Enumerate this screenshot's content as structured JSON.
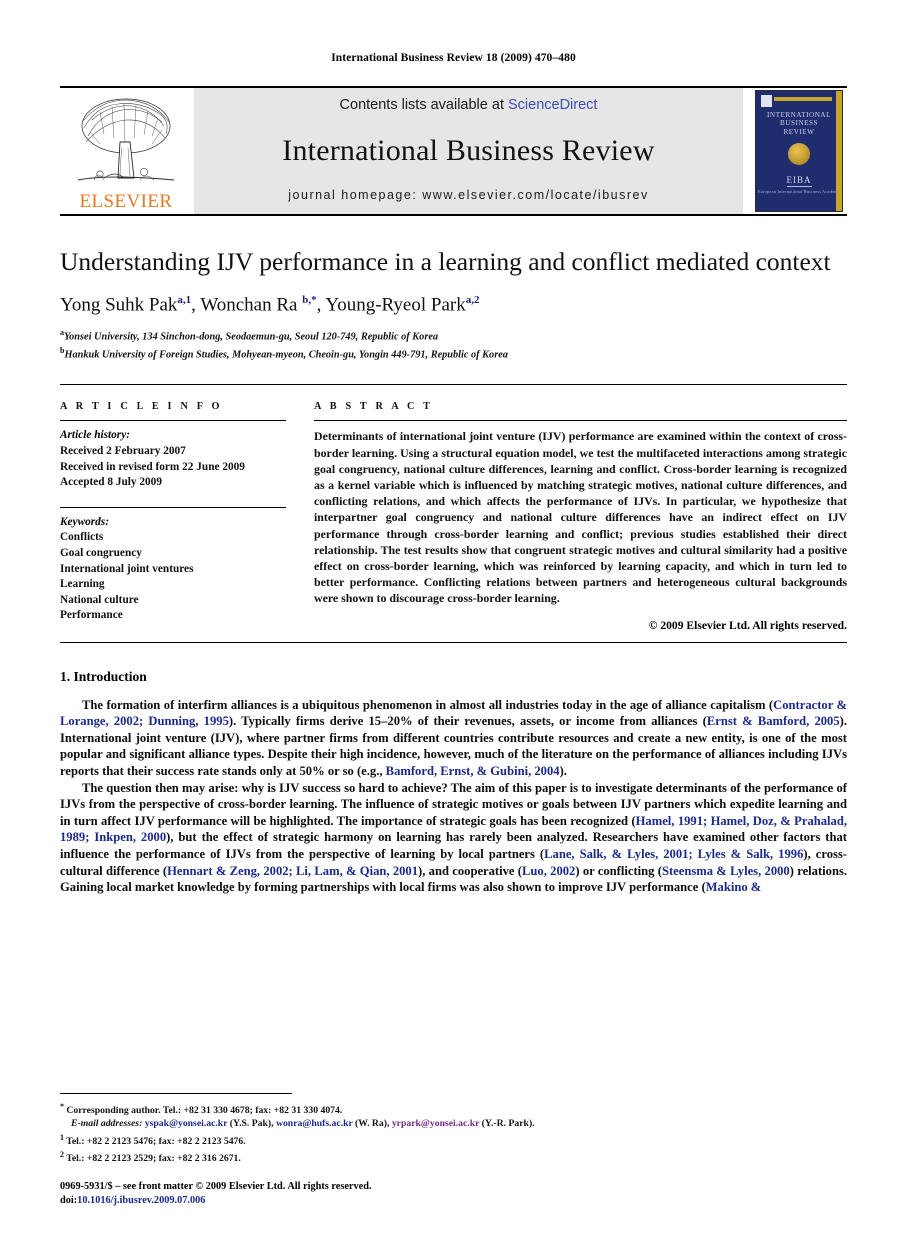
{
  "running_head": "International Business Review 18 (2009) 470–480",
  "masthead": {
    "publisher": "ELSEVIER",
    "contents_prefix": "Contents lists available at ",
    "contents_link": "ScienceDirect",
    "journal_title": "International Business Review",
    "homepage": "journal homepage: www.elsevier.com/locate/ibusrev",
    "cover": {
      "title_lines": [
        "INTERNATIONAL",
        "BUSINESS",
        "REVIEW"
      ],
      "society": "EIBA",
      "society_sub": "European International Business Academy"
    }
  },
  "article": {
    "title": "Understanding IJV performance in a learning and conflict mediated context",
    "authors": [
      {
        "name": "Yong Suhk Pak",
        "sup": "a,1"
      },
      {
        "name": "Wonchan Ra",
        "sup": "b,*"
      },
      {
        "name": "Young-Ryeol Park",
        "sup": "a,2"
      }
    ],
    "affiliations": [
      {
        "marker": "a",
        "text": "Yonsei University, 134 Sinchon-dong, Seodaemun-gu, Seoul 120-749, Republic of Korea"
      },
      {
        "marker": "b",
        "text": "Hankuk University of Foreign Studies, Mohyean-myeon, Cheoin-gu, Yongin 449-791, Republic of Korea"
      }
    ]
  },
  "info": {
    "heading": "A R T I C L E   I N F O",
    "history_label": "Article history:",
    "history": [
      "Received 2 February 2007",
      "Received in revised form 22 June 2009",
      "Accepted 8 July 2009"
    ],
    "keywords_label": "Keywords:",
    "keywords": [
      "Conflicts",
      "Goal congruency",
      "International joint ventures",
      "Learning",
      "National culture",
      "Performance"
    ]
  },
  "abstract": {
    "heading": "A B S T R A C T",
    "text": "Determinants of international joint venture (IJV) performance are examined within the context of cross-border learning. Using a structural equation model, we test the multifaceted interactions among strategic goal congruency, national culture differences, learning and conflict. Cross-border learning is recognized as a kernel variable which is influenced by matching strategic motives, national culture differences, and conflicting relations, and which affects the performance of IJVs. In particular, we hypothesize that interpartner goal congruency and national culture differences have an indirect effect on IJV performance through cross-border learning and conflict; previous studies established their direct relationship. The test results show that congruent strategic motives and cultural similarity had a positive effect on cross-border learning, which was reinforced by learning capacity, and which in turn led to better performance. Conflicting relations between partners and heterogeneous cultural backgrounds were shown to discourage cross-border learning.",
    "copyright": "© 2009 Elsevier Ltd. All rights reserved."
  },
  "introduction": {
    "heading": "1. Introduction",
    "paragraph1": [
      {
        "t": "The formation of interfirm alliances is a ubiquitous phenomenon in almost all industries today in the age of alliance capitalism ("
      },
      {
        "t": "Contractor & Lorange, 2002; Dunning, 1995",
        "c": true
      },
      {
        "t": "). Typically firms derive 15–20% of their revenues, assets, or income from alliances ("
      },
      {
        "t": "Ernst & Bamford, 2005",
        "c": true
      },
      {
        "t": "). International joint venture (IJV), where partner firms from different countries contribute resources and create a new entity, is one of the most popular and significant alliance types. Despite their high incidence, however, much of the literature on the performance of alliances including IJVs reports that their success rate stands only at 50% or so (e.g., "
      },
      {
        "t": "Bamford, Ernst, & Gubini, 2004",
        "c": true
      },
      {
        "t": ")."
      }
    ],
    "paragraph2": [
      {
        "t": "The question then may arise: why is IJV success so hard to achieve? The aim of this paper is to investigate determinants of the performance of IJVs from the perspective of cross-border learning. The influence of strategic motives or goals between IJV partners which expedite learning and in turn affect IJV performance will be highlighted. The importance of strategic goals has been recognized ("
      },
      {
        "t": "Hamel, 1991; Hamel, Doz, & Prahalad, 1989; Inkpen, 2000",
        "c": true
      },
      {
        "t": "), but the effect of strategic harmony on learning has rarely been analyzed. Researchers have examined other factors that influence the performance of IJVs from the perspective of learning by local partners ("
      },
      {
        "t": "Lane, Salk, & Lyles, 2001; Lyles & Salk, 1996",
        "c": true
      },
      {
        "t": "), cross-cultural difference ("
      },
      {
        "t": "Hennart & Zeng, 2002; Li, Lam, & Qian, 2001",
        "c": true
      },
      {
        "t": "), and cooperative ("
      },
      {
        "t": "Luo, 2002",
        "c": true
      },
      {
        "t": ") or conflicting ("
      },
      {
        "t": "Steensma & Lyles, 2000",
        "c": true
      },
      {
        "t": ") relations. Gaining local market knowledge by forming partnerships with local firms was also shown to improve IJV performance ("
      },
      {
        "t": "Makino &",
        "c": true
      }
    ]
  },
  "footnotes": {
    "corresponding": "Corresponding author. Tel.: +82 31 330 4678; fax: +82 31 330 4074.",
    "email_label": "E-mail addresses:",
    "emails": [
      {
        "addr": "yspak@yonsei.ac.kr",
        "who": "(Y.S. Pak)",
        "style": "a"
      },
      {
        "addr": "wonra@hufs.ac.kr",
        "who": "(W. Ra)",
        "style": "a"
      },
      {
        "addr": "yrpark@yonsei.ac.kr",
        "who": "(Y.-R. Park)",
        "style": "b"
      }
    ],
    "note1": {
      "marker": "1",
      "text": "Tel.: +82 2 2123 5476; fax: +82 2 2123 5476."
    },
    "note2": {
      "marker": "2",
      "text": "Tel.: +82 2 2123 2529; fax: +82 2 316 2671."
    }
  },
  "imprint": {
    "issn_line": "0969-5931/$ – see front matter © 2009 Elsevier Ltd. All rights reserved.",
    "doi_prefix": "doi:",
    "doi": "10.1016/j.ibusrev.2009.07.006"
  }
}
